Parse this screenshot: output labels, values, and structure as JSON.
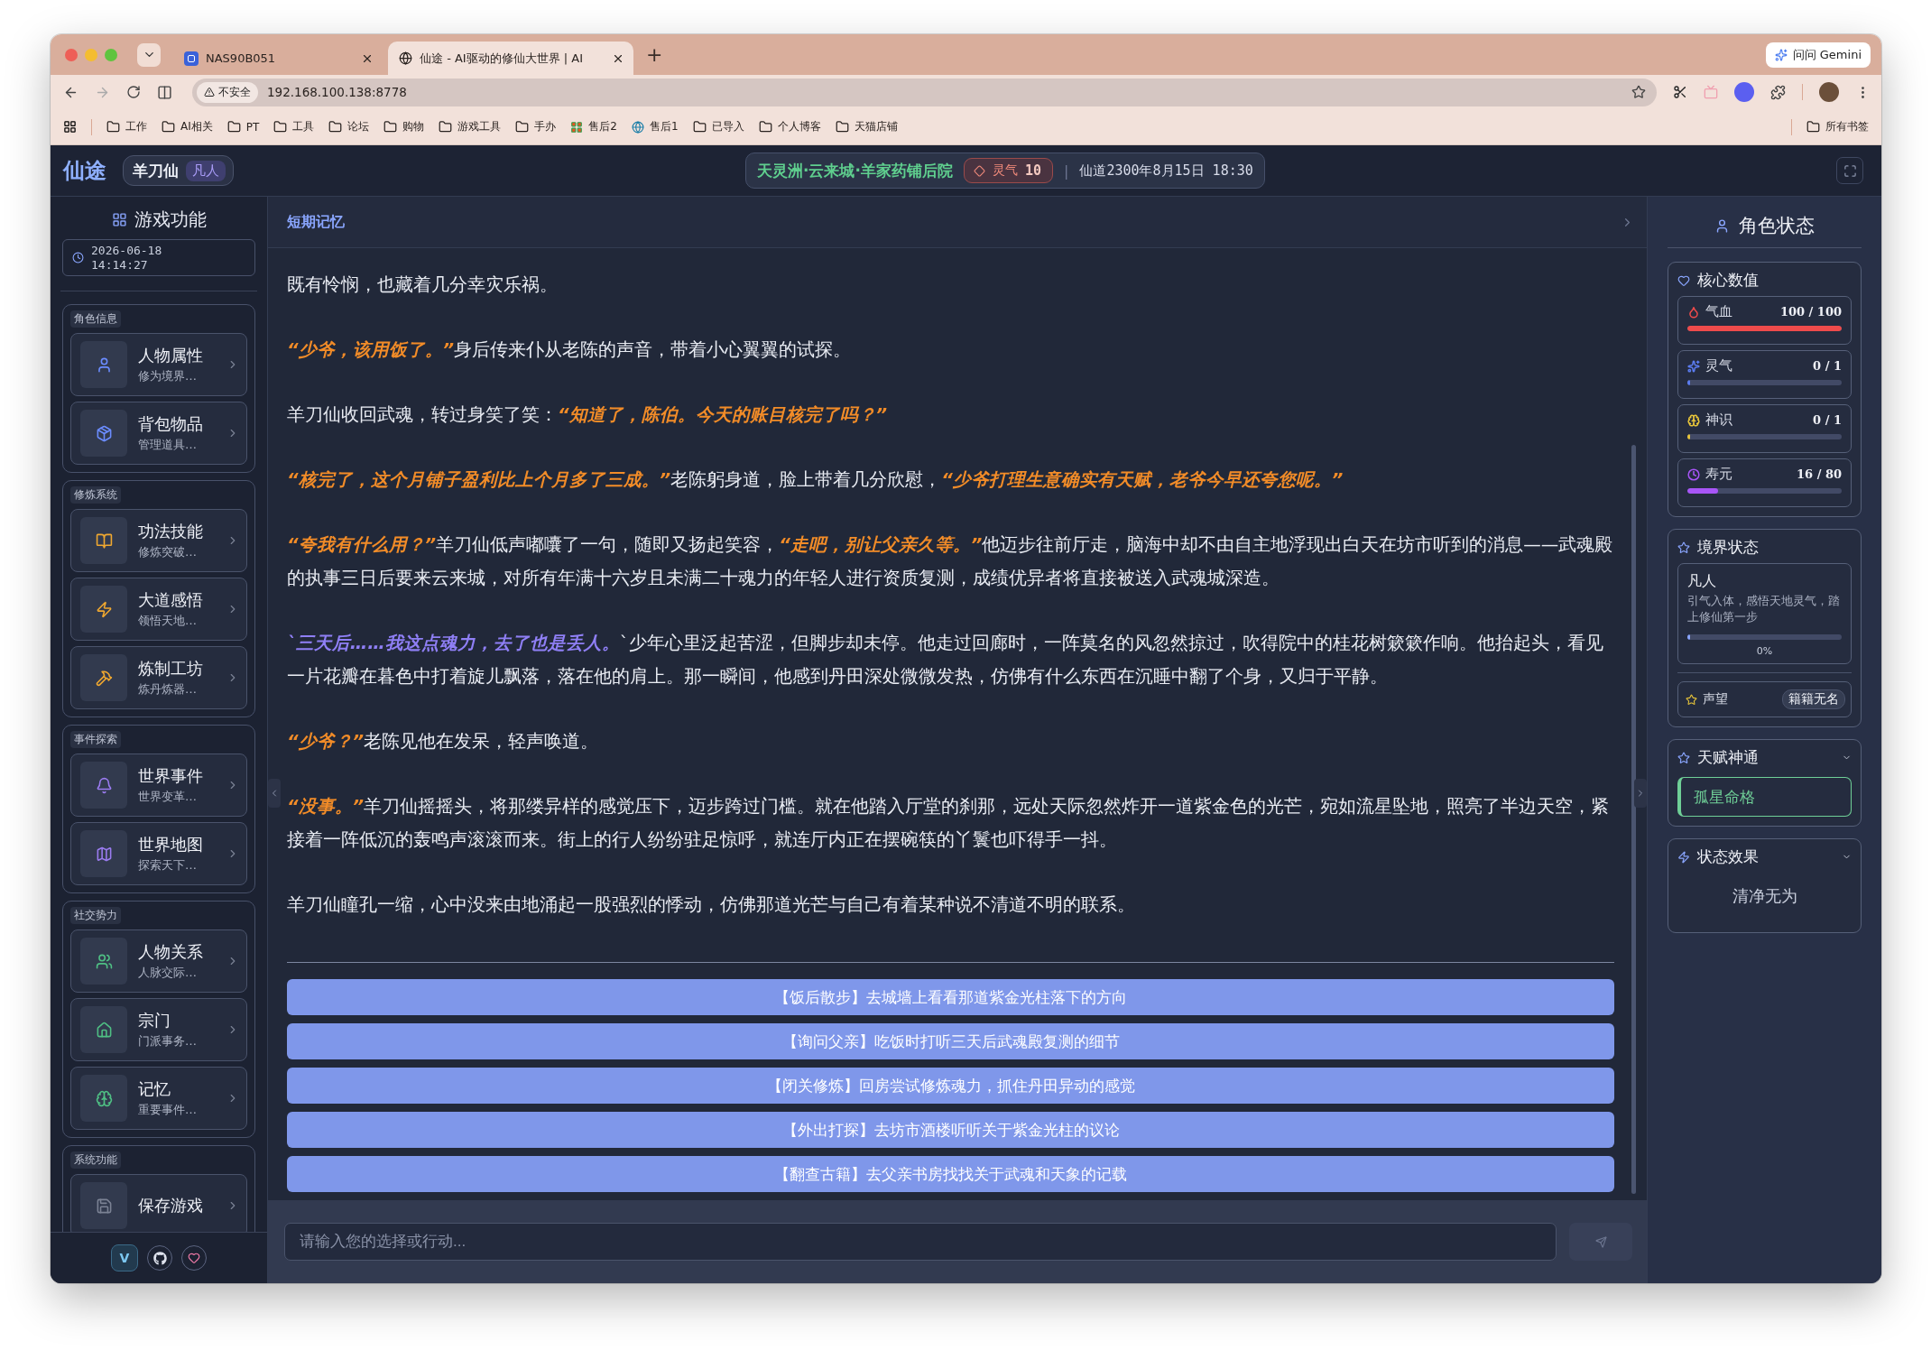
{
  "browser": {
    "tabs": [
      {
        "title": "NAS90B051",
        "selected": false
      },
      {
        "title": "仙途 - AI驱动的修仙大世界 | AI",
        "selected": true
      }
    ],
    "new_tab": "+",
    "gemini": "问问 Gemini",
    "security": "不安全",
    "url": "192.168.100.138:8778",
    "bookmarks": [
      {
        "label": "工作",
        "kind": "folder"
      },
      {
        "label": "AI相关",
        "kind": "folder"
      },
      {
        "label": "PT",
        "kind": "folder"
      },
      {
        "label": "工具",
        "kind": "folder"
      },
      {
        "label": "论坛",
        "kind": "folder"
      },
      {
        "label": "购物",
        "kind": "folder"
      },
      {
        "label": "游戏工具",
        "kind": "folder"
      },
      {
        "label": "手办",
        "kind": "folder"
      },
      {
        "label": "售后2",
        "kind": "tiles"
      },
      {
        "label": "售后1",
        "kind": "site"
      },
      {
        "label": "已导入",
        "kind": "folder"
      },
      {
        "label": "个人博客",
        "kind": "folder"
      },
      {
        "label": "天猫店铺",
        "kind": "folder"
      }
    ],
    "all_bookmarks": "所有书签"
  },
  "header": {
    "logo": "仙途",
    "player": "羊刀仙",
    "rank": "凡人",
    "location": "天灵洲·云来城·羊家药铺后院",
    "spirit_label": "灵气",
    "spirit_value": "10",
    "separator": "|",
    "date": "仙道2300年8月15日 18:30"
  },
  "sidebar": {
    "title": "游戏功能",
    "date": "2026-06-18",
    "time": "14:14:27",
    "groups": [
      {
        "title": "角色信息",
        "color": "#6b8cff",
        "items": [
          {
            "title": "人物属性",
            "subtitle": "修为境界…"
          },
          {
            "title": "背包物品",
            "subtitle": "管理道具…"
          }
        ]
      },
      {
        "title": "修炼系统",
        "color": "#f0a830",
        "items": [
          {
            "title": "功法技能",
            "subtitle": "修炼突破…"
          },
          {
            "title": "大道感悟",
            "subtitle": "领悟天地…"
          },
          {
            "title": "炼制工坊",
            "subtitle": "炼丹炼器…"
          }
        ]
      },
      {
        "title": "事件探索",
        "color": "#9b7cf0",
        "items": [
          {
            "title": "世界事件",
            "subtitle": "世界变革…"
          },
          {
            "title": "世界地图",
            "subtitle": "探索天下…"
          }
        ]
      },
      {
        "title": "社交势力",
        "color": "#4fbf84",
        "items": [
          {
            "title": "人物关系",
            "subtitle": "人脉交际…"
          },
          {
            "title": "宗门",
            "subtitle": "门派事务…"
          },
          {
            "title": "记忆",
            "subtitle": "重要事件…"
          }
        ]
      },
      {
        "title": "系统功能",
        "color": "#7b8294",
        "items": [
          {
            "title": "保存游戏"
          }
        ]
      }
    ],
    "version": "V"
  },
  "memory": {
    "title": "短期记忆"
  },
  "story": [
    {
      "segments": [
        {
          "kind": "narration",
          "text": "既有怜悯，也藏着几分幸灾乐祸。"
        }
      ]
    },
    {
      "segments": [
        {
          "kind": "speech",
          "text": "“少爷，该用饭了。”"
        },
        {
          "kind": "narration",
          "text": "身后传来仆从老陈的声音，带着小心翼翼的试探。"
        }
      ]
    },
    {
      "segments": [
        {
          "kind": "narration",
          "text": "羊刀仙收回武魂，转过身笑了笑："
        },
        {
          "kind": "speech",
          "text": "“知道了，陈伯。今天的账目核完了吗？”"
        }
      ]
    },
    {
      "segments": [
        {
          "kind": "speech",
          "text": "“核完了，这个月铺子盈利比上个月多了三成。”"
        },
        {
          "kind": "narration",
          "text": "老陈躬身道，脸上带着几分欣慰，"
        },
        {
          "kind": "speech",
          "text": "“少爷打理生意确实有天赋，老爷今早还夸您呢。”"
        }
      ]
    },
    {
      "segments": [
        {
          "kind": "speech",
          "text": "“夸我有什么用？”"
        },
        {
          "kind": "narration",
          "text": "羊刀仙低声嘟囔了一句，随即又扬起笑容，"
        },
        {
          "kind": "speech",
          "text": "“走吧，别让父亲久等。”"
        },
        {
          "kind": "narration",
          "text": "他迈步往前厅走，脑海中却不由自主地浮现出白天在坊市听到的消息——武魂殿的执事三日后要来云来城，对所有年满十六岁且未满二十魂力的年轻人进行资质复测，成绩优异者将直接被送入武魂城深造。"
        }
      ]
    },
    {
      "segments": [
        {
          "kind": "thought",
          "text": "`三天后……我这点魂力，去了也是丢人。"
        },
        {
          "kind": "narration",
          "text": "`少年心里泛起苦涩，但脚步却未停。他走过回廊时，一阵莫名的风忽然掠过，吹得院中的桂花树簌簌作响。他抬起头，看见一片花瓣在暮色中打着旋儿飘落，落在他的肩上。那一瞬间，他感到丹田深处微微发热，仿佛有什么东西在沉睡中翻了个身，又归于平静。"
        }
      ]
    },
    {
      "segments": [
        {
          "kind": "speech",
          "text": "“少爷？”"
        },
        {
          "kind": "narration",
          "text": "老陈见他在发呆，轻声唤道。"
        }
      ]
    },
    {
      "segments": [
        {
          "kind": "speech",
          "text": "“没事。”"
        },
        {
          "kind": "narration",
          "text": "羊刀仙摇摇头，将那缕异样的感觉压下，迈步跨过门槛。就在他踏入厅堂的刹那，远处天际忽然炸开一道紫金色的光芒，宛如流星坠地，照亮了半边天空，紧接着一阵低沉的轰鸣声滚滚而来。街上的行人纷纷驻足惊呼，就连厅内正在摆碗筷的丫鬟也吓得手一抖。"
        }
      ]
    },
    {
      "segments": [
        {
          "kind": "narration",
          "text": "羊刀仙瞳孔一缩，心中没来由地涌起一股强烈的悸动，仿佛那道光芒与自己有着某种说不清道不明的联系。"
        }
      ]
    }
  ],
  "choices": [
    "【饭后散步】去城墙上看看那道紫金光柱落下的方向",
    "【询问父亲】吃饭时打听三天后武魂殿复测的细节",
    "【闭关修炼】回房尝试修炼魂力，抓住丹田异动的感觉",
    "【外出打探】去坊市酒楼听听关于紫金光柱的议论",
    "【翻查古籍】去父亲书房找找关于武魂和天象的记载"
  ],
  "input": {
    "placeholder": "请输入您的选择或行动..."
  },
  "status": {
    "title": "角色状态",
    "core_title": "核心数值",
    "stats": [
      {
        "label": "气血",
        "value": "100 / 100",
        "level": 1,
        "color": "#ef4b4b"
      },
      {
        "label": "灵气",
        "value": "0 / 1",
        "level": 0,
        "color": "#5b7cf0"
      },
      {
        "label": "神识",
        "value": "0 / 1",
        "level": 0,
        "color": "#e8c53a"
      },
      {
        "label": "寿元",
        "value": "16 / 80",
        "level": 0.2,
        "color": "#a855f7"
      }
    ],
    "realm_title": "境界状态",
    "realm": {
      "name": "凡人",
      "description": "引气入体，感悟天地灵气，踏上修仙第一步",
      "level": 0,
      "percent": "0%"
    },
    "reputation": {
      "label": "声望",
      "value": "籍籍无名"
    },
    "talents": {
      "title": "天赋神通",
      "expanded": true,
      "items": [
        "孤星命格"
      ]
    },
    "effects": {
      "title": "状态效果",
      "expanded": true,
      "items": [
        "清净无为"
      ]
    }
  }
}
